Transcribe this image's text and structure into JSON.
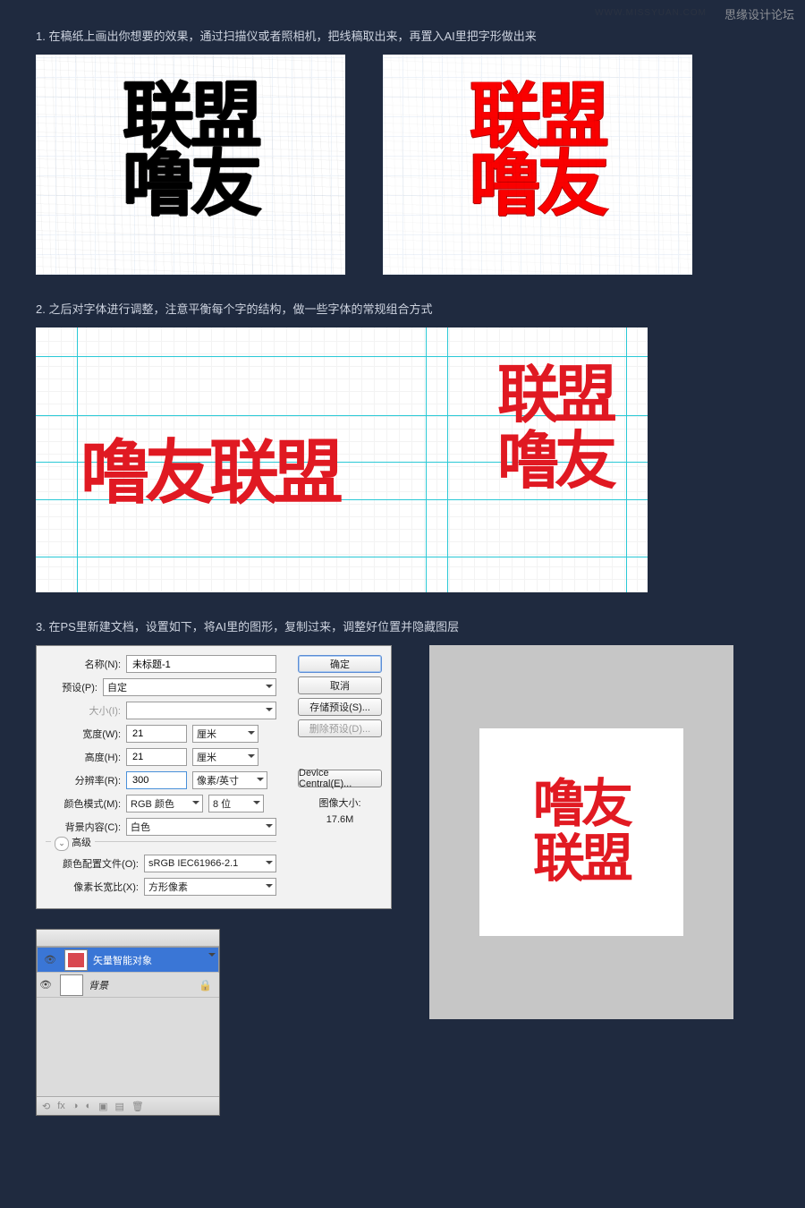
{
  "watermark": {
    "forum": "思缘设计论坛",
    "url": "WWW.MISSYUAN.COM"
  },
  "steps": {
    "s1": "1. 在稿纸上画出你想要的效果，通过扫描仪或者照相机，把线稿取出来，再置入AI里把字形做出来",
    "s2": "2. 之后对字体进行调整，注意平衡每个字的结构，做一些字体的常规组合方式",
    "s3": "3. 在PS里新建文档，设置如下，将AI里的图形，复制过来，调整好位置并隐藏图层"
  },
  "glyphs": {
    "line1": "联盟",
    "line2": "噜友",
    "horiz": "噜友联盟",
    "stackA": "联盟",
    "stackB": "噜友",
    "finalA": "噜友",
    "finalB": "联盟"
  },
  "dialog": {
    "name_lbl": "名称(N):",
    "name_val": "未标题-1",
    "preset_lbl": "预设(P):",
    "preset_val": "自定",
    "size_lbl": "大小(I):",
    "width_lbl": "宽度(W):",
    "width_val": "21",
    "width_unit": "厘米",
    "height_lbl": "高度(H):",
    "height_val": "21",
    "height_unit": "厘米",
    "res_lbl": "分辨率(R):",
    "res_val": "300",
    "res_unit": "像素/英寸",
    "mode_lbl": "颜色模式(M):",
    "mode_val": "RGB 颜色",
    "mode_bits": "8 位",
    "bg_lbl": "背景内容(C):",
    "bg_val": "白色",
    "adv_lbl": "高级",
    "profile_lbl": "颜色配置文件(O):",
    "profile_val": "sRGB IEC61966-2.1",
    "aspect_lbl": "像素长宽比(X):",
    "aspect_val": "方形像素",
    "btn_ok": "确定",
    "btn_cancel": "取消",
    "btn_save": "存储预设(S)...",
    "btn_del": "删除预设(D)...",
    "btn_dc": "Device Central(E)...",
    "size_title": "图像大小:",
    "size_val": "17.6M"
  },
  "layers": {
    "l1": "矢量智能对象",
    "l2": "背景"
  }
}
